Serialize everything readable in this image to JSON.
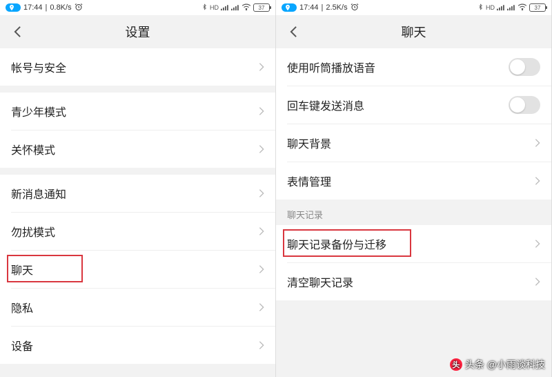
{
  "left": {
    "status": {
      "time": "17:44",
      "speed": "0.8K/s",
      "battery": "37"
    },
    "nav_title": "设置",
    "rows": {
      "account": "帐号与安全",
      "youth": "青少年模式",
      "care": "关怀模式",
      "notify": "新消息通知",
      "dnd": "勿扰模式",
      "chat": "聊天",
      "privacy": "隐私",
      "devices": "设备"
    }
  },
  "right": {
    "status": {
      "time": "17:44",
      "speed": "2.5K/s",
      "battery": "37"
    },
    "nav_title": "聊天",
    "rows": {
      "earpiece": "使用听筒播放语音",
      "enter_send": "回车键发送消息",
      "background": "聊天背景",
      "emoji": "表情管理",
      "section": "聊天记录",
      "backup": "聊天记录备份与迁移",
      "clear": "清空聊天记录"
    }
  },
  "watermark": "头条 @小雨谈科技"
}
